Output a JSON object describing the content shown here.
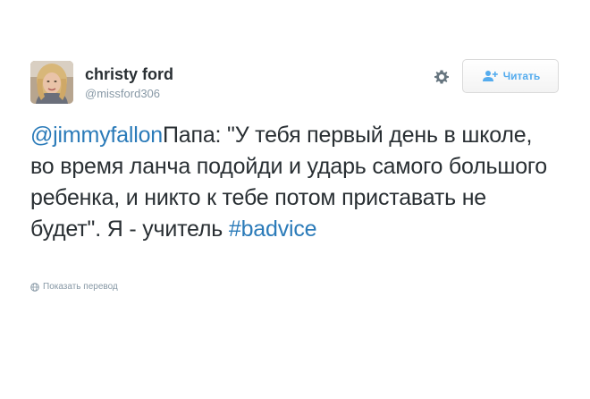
{
  "user": {
    "display_name": "christy ford",
    "screen_name": "@missford306",
    "avatar_icon": "user-avatar-photo"
  },
  "actions": {
    "settings_icon": "gear-icon",
    "follow_label": "Читать",
    "follow_icon": "add-user-icon"
  },
  "tweet": {
    "mention": "@jimmyfallon",
    "text": "Папа: \"У тебя первый день в школе, во время ланча подойди и ударь самого большого ребенка, и никто к тебе потом приставать не будет\". Я - учитель ",
    "hashtag": "#badvice"
  },
  "translate": {
    "label": "Показать перевод",
    "icon": "globe-icon"
  },
  "colors": {
    "link": "#2b7bb9",
    "follow_text": "#55acee",
    "muted": "#8899a6",
    "body_text": "#292f33"
  }
}
